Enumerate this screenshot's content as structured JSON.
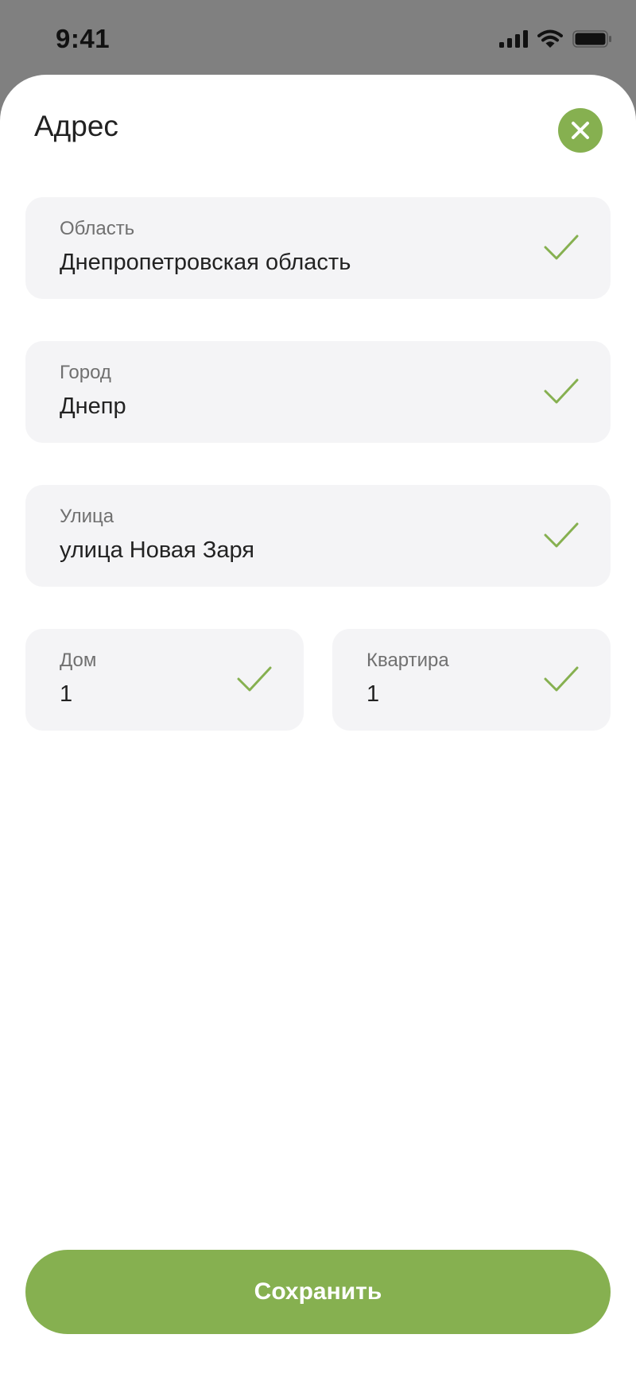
{
  "status_bar": {
    "time": "9:41",
    "icons": [
      "signal-icon",
      "wifi-icon",
      "battery-icon"
    ]
  },
  "sheet": {
    "title": "Адрес",
    "close_icon": "close-icon"
  },
  "fields": {
    "region": {
      "label": "Область",
      "value": "Днепропетровская область",
      "valid": true
    },
    "city": {
      "label": "Город",
      "value": "Днепр",
      "valid": true
    },
    "street": {
      "label": "Улица",
      "value": "улица Новая Заря",
      "valid": true
    },
    "house": {
      "label": "Дом",
      "value": "1",
      "valid": true
    },
    "apartment": {
      "label": "Квартира",
      "value": "1",
      "valid": true
    }
  },
  "actions": {
    "save_label": "Сохранить"
  },
  "colors": {
    "accent": "#86b050",
    "field_background": "#f4f4f6",
    "overlay": "#808080",
    "label": "#707070",
    "text": "#222222"
  }
}
